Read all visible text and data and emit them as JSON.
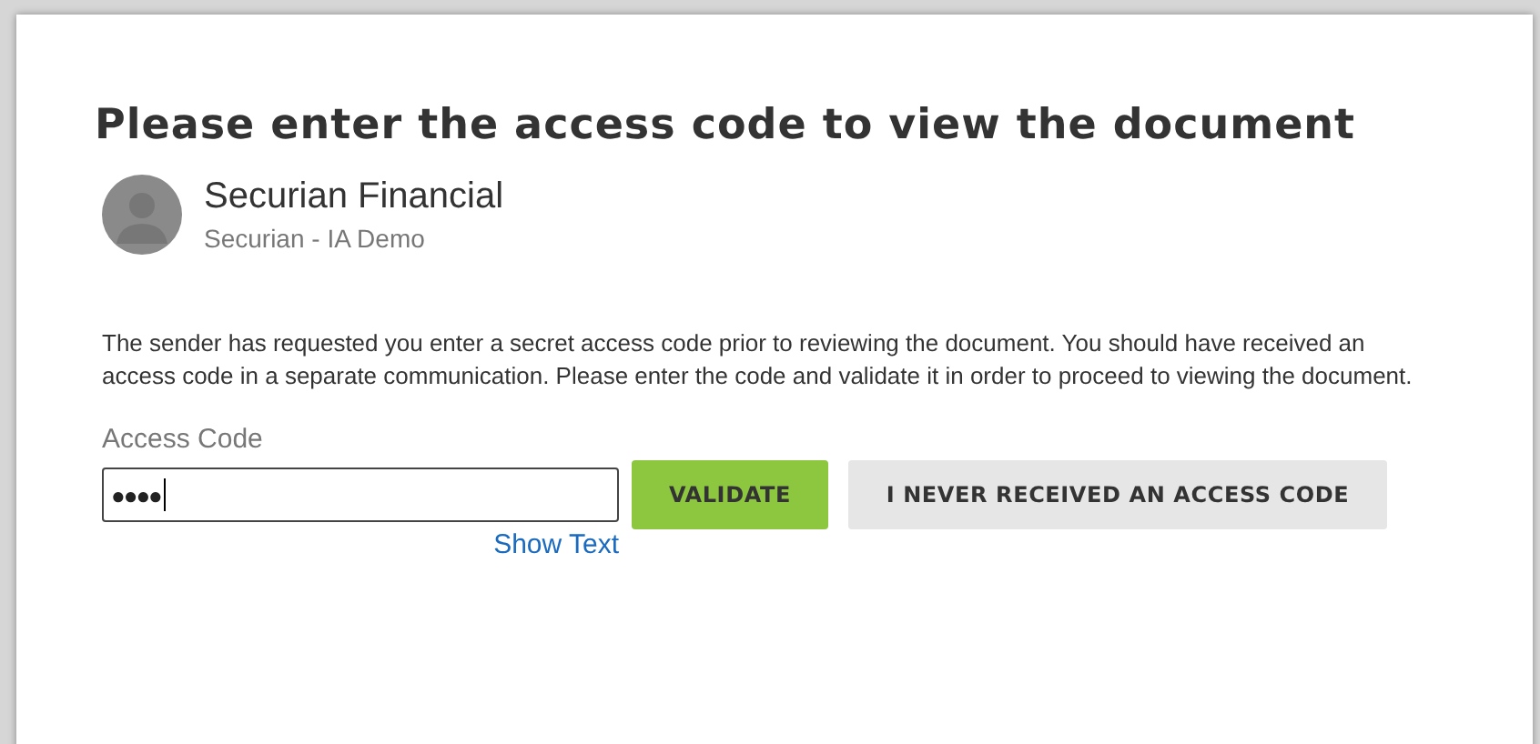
{
  "title": "Please enter the access code to view the document",
  "sender": {
    "name": "Securian Financial",
    "subtitle": "Securian - IA Demo"
  },
  "message": "The sender has requested you enter a secret access code prior to reviewing the document. You should have received an access code in a separate communication. Please enter the code and validate it in order to proceed to viewing the document.",
  "access_code": {
    "label": "Access Code",
    "value": "●●●●"
  },
  "buttons": [
    {
      "label": "VALIDATE",
      "kind": "primary"
    },
    {
      "label": "I NEVER RECEIVED AN ACCESS CODE",
      "kind": "secondary"
    }
  ],
  "show_text_link": "Show Text"
}
